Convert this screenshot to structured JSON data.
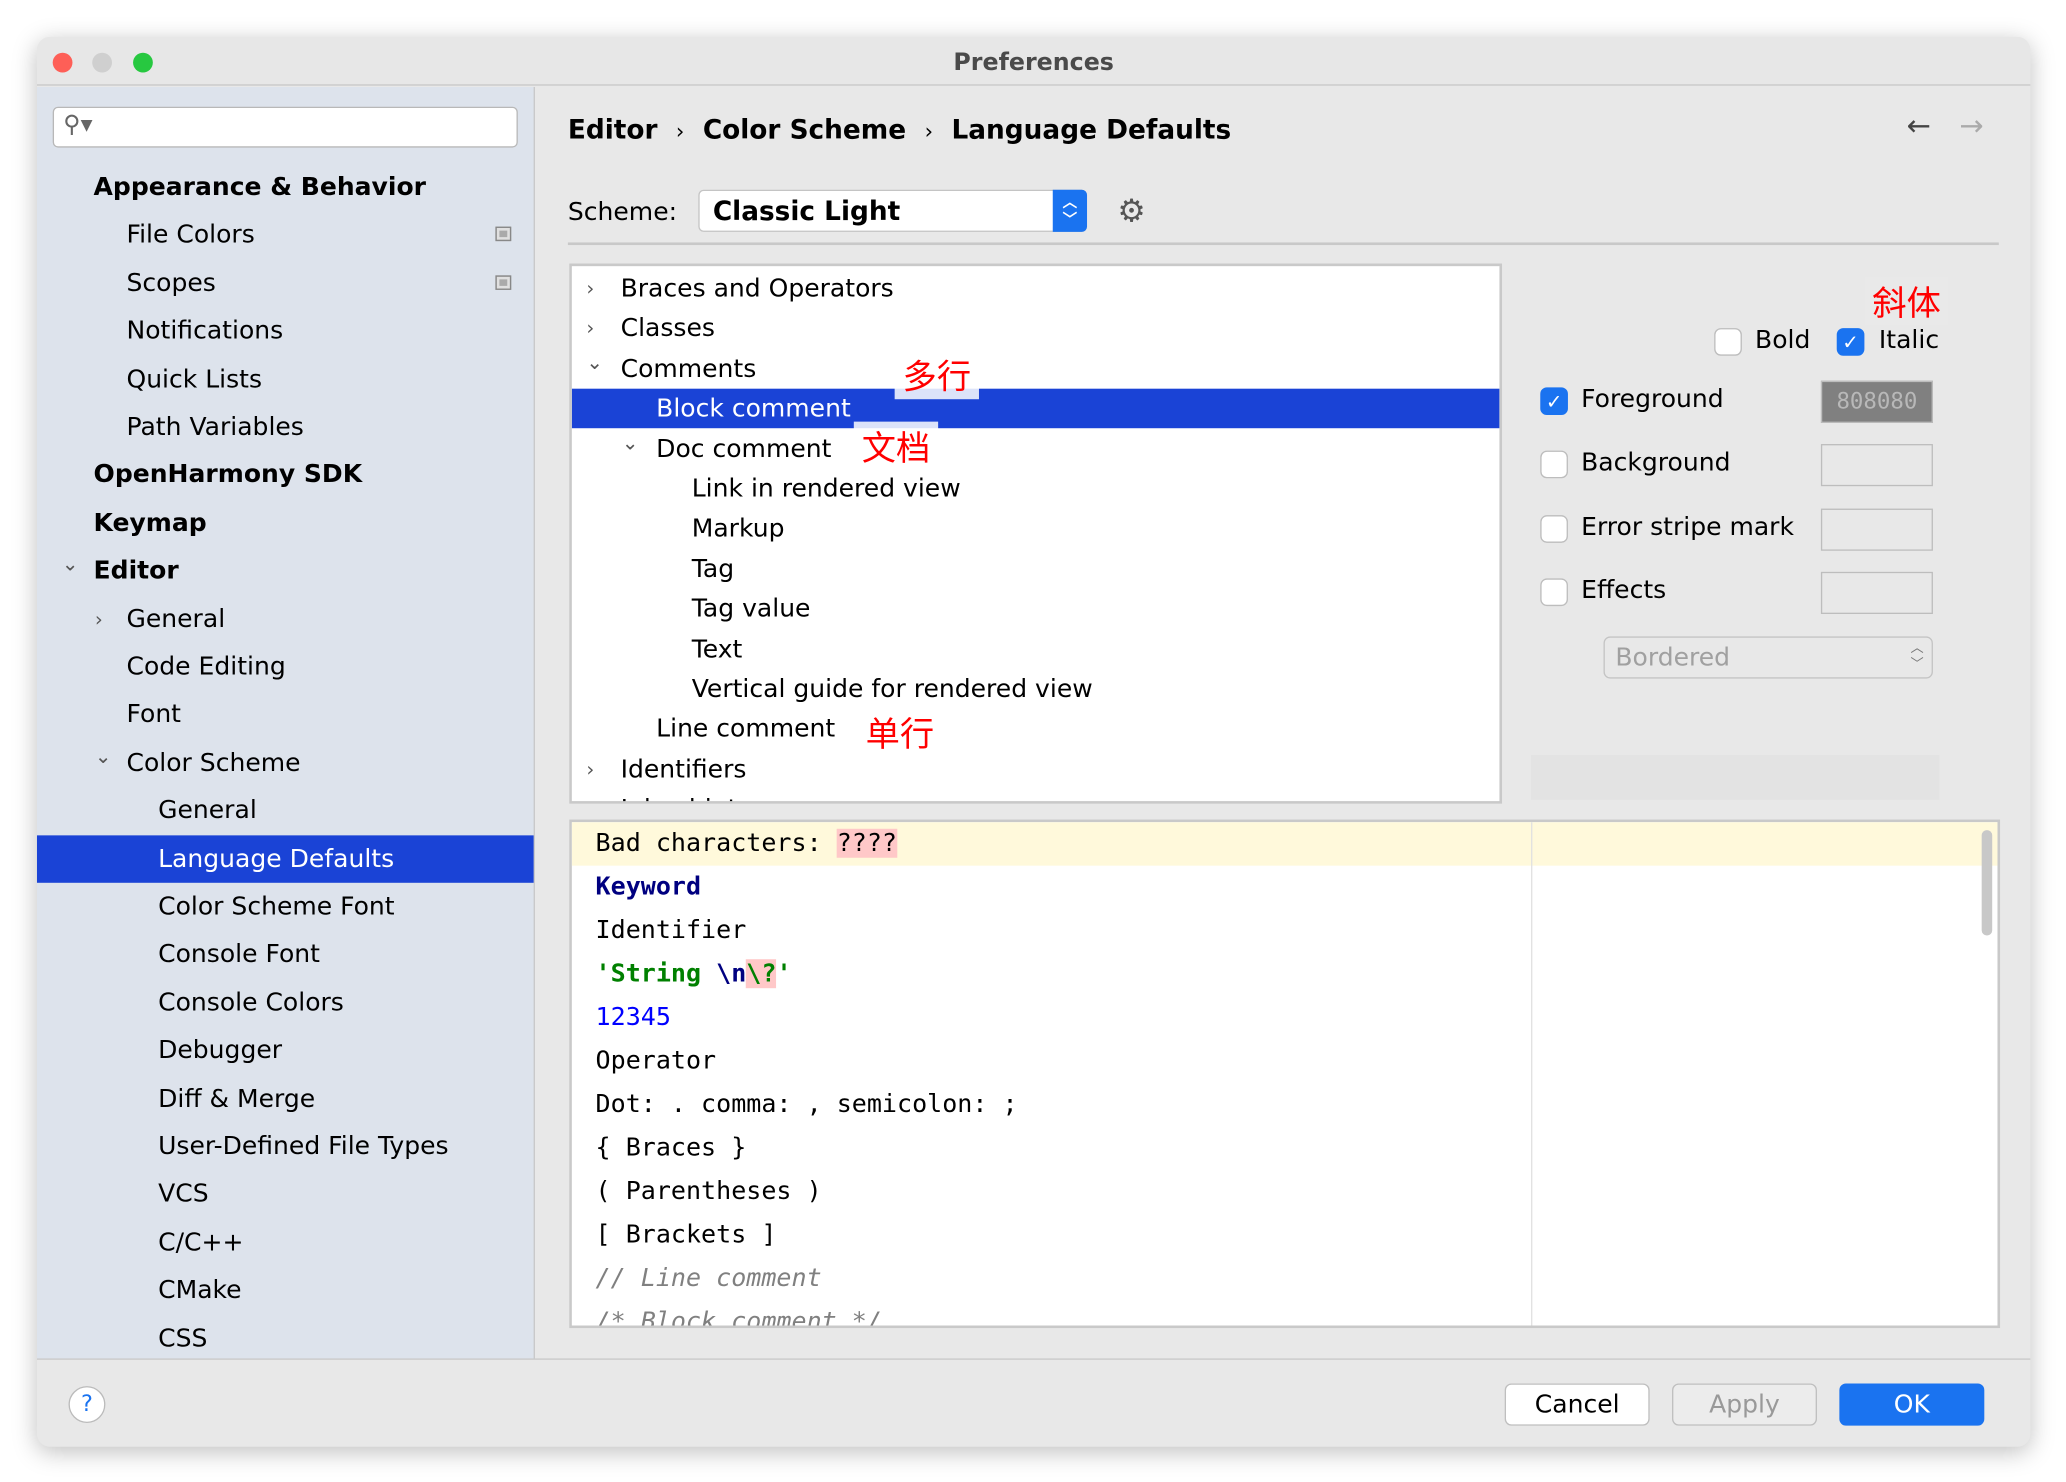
{
  "window": {
    "title": "Preferences"
  },
  "sidebar": {
    "search_placeholder": "",
    "items": [
      {
        "label": "Appearance & Behavior",
        "level": 0,
        "bold": true
      },
      {
        "label": "File Colors",
        "level": 1,
        "badge": true
      },
      {
        "label": "Scopes",
        "level": 1,
        "badge": true
      },
      {
        "label": "Notifications",
        "level": 1
      },
      {
        "label": "Quick Lists",
        "level": 1
      },
      {
        "label": "Path Variables",
        "level": 1
      },
      {
        "label": "OpenHarmony SDK",
        "level": 0,
        "bold": true
      },
      {
        "label": "Keymap",
        "level": 0,
        "bold": true
      },
      {
        "label": "Editor",
        "level": 0,
        "bold": true,
        "expanded": true
      },
      {
        "label": "General",
        "level": 1,
        "collapsed": true
      },
      {
        "label": "Code Editing",
        "level": 1
      },
      {
        "label": "Font",
        "level": 1
      },
      {
        "label": "Color Scheme",
        "level": 1,
        "expanded": true
      },
      {
        "label": "General",
        "level": 2
      },
      {
        "label": "Language Defaults",
        "level": 2,
        "selected": true
      },
      {
        "label": "Color Scheme Font",
        "level": 2
      },
      {
        "label": "Console Font",
        "level": 2
      },
      {
        "label": "Console Colors",
        "level": 2
      },
      {
        "label": "Debugger",
        "level": 2
      },
      {
        "label": "Diff & Merge",
        "level": 2
      },
      {
        "label": "User-Defined File Types",
        "level": 2
      },
      {
        "label": "VCS",
        "level": 2
      },
      {
        "label": "C/C++",
        "level": 2
      },
      {
        "label": "CMake",
        "level": 2
      },
      {
        "label": "CSS",
        "level": 2
      }
    ]
  },
  "breadcrumb": [
    "Editor",
    "Color Scheme",
    "Language Defaults"
  ],
  "scheme": {
    "label": "Scheme:",
    "value": "Classic Light"
  },
  "tree": [
    {
      "label": "Braces and Operators",
      "level": 0,
      "collapsed": true
    },
    {
      "label": "Classes",
      "level": 0,
      "collapsed": true
    },
    {
      "label": "Comments",
      "level": 0,
      "expanded": true
    },
    {
      "label": "Block comment",
      "level": 1,
      "selected": true
    },
    {
      "label": "Doc comment",
      "level": 1,
      "expanded": true
    },
    {
      "label": "Link in rendered view",
      "level": 2
    },
    {
      "label": "Markup",
      "level": 2
    },
    {
      "label": "Tag",
      "level": 2
    },
    {
      "label": "Tag value",
      "level": 2
    },
    {
      "label": "Text",
      "level": 2
    },
    {
      "label": "Vertical guide for rendered view",
      "level": 2
    },
    {
      "label": "Line comment",
      "level": 1
    },
    {
      "label": "Identifiers",
      "level": 0,
      "collapsed": true
    },
    {
      "label": "Inlay hints",
      "level": 0,
      "collapsed": true
    }
  ],
  "annotations": {
    "multiline": "多行",
    "doc": "文档",
    "single": "单行",
    "italic": "斜体"
  },
  "props": {
    "bold": {
      "label": "Bold",
      "checked": false
    },
    "italic": {
      "label": "Italic",
      "checked": true
    },
    "foreground": {
      "label": "Foreground",
      "checked": true,
      "value": "808080"
    },
    "background": {
      "label": "Background",
      "checked": false
    },
    "error_stripe": {
      "label": "Error stripe mark",
      "checked": false
    },
    "effects": {
      "label": "Effects",
      "checked": false
    },
    "effect_type": "Bordered"
  },
  "preview": {
    "bad_label": "Bad characters: ",
    "bad_chars": "????",
    "keyword": "Keyword",
    "identifier": "Identifier",
    "string_start": "'String ",
    "string_esc": "\\n",
    "string_bad": "\\?",
    "string_end": "'",
    "number": "12345",
    "operator": "Operator",
    "dot_line": "Dot: . comma: , semicolon: ;",
    "braces": "{ Braces }",
    "parens": "( Parentheses )",
    "brackets": "[ Brackets ]",
    "line_comment": "// Line comment",
    "block_comment": "/* Block comment */"
  },
  "colors": {
    "selection": "#1a43d6",
    "accent": "#1a73f0",
    "keyword": "#000080",
    "string": "#008000",
    "number": "#0000ff",
    "comment": "#808080",
    "bad_bg": "#ffc8c8",
    "caret_row": "#fff9db"
  },
  "footer": {
    "help": "?",
    "cancel": "Cancel",
    "apply": "Apply",
    "ok": "OK"
  }
}
